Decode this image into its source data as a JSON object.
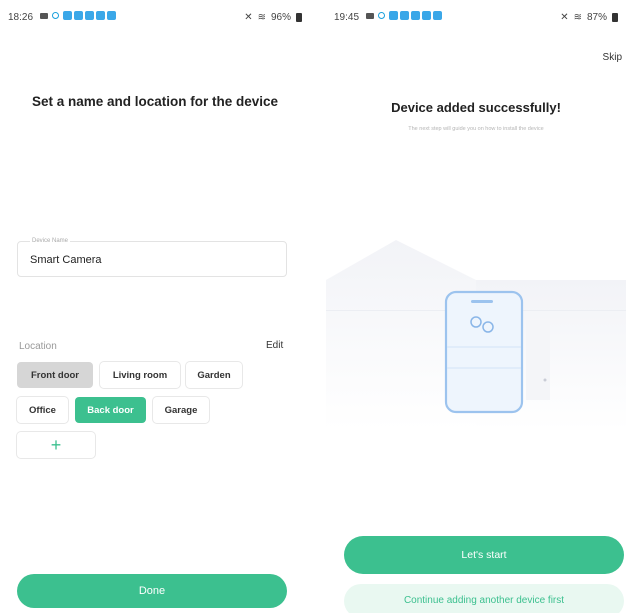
{
  "left_screen": {
    "status_bar": {
      "time": "18:26",
      "system": "96%"
    },
    "title": "Set a name and location for the device",
    "device_name": {
      "label": "Device Name",
      "value": "Smart Camera"
    },
    "location": {
      "label": "Location",
      "edit_label": "Edit",
      "rooms": [
        {
          "label": "Front door",
          "state": "highlighted"
        },
        {
          "label": "Living room",
          "state": "normal"
        },
        {
          "label": "Garden",
          "state": "normal"
        },
        {
          "label": "Office",
          "state": "normal"
        },
        {
          "label": "Back door",
          "state": "selected"
        },
        {
          "label": "Garage",
          "state": "normal"
        }
      ],
      "add_label": "+"
    },
    "done_label": "Done"
  },
  "right_screen": {
    "status_bar": {
      "time": "19:45",
      "system": "87%"
    },
    "skip_label": "Skip",
    "title": "Device added successfully!",
    "subtitle": "The next step will guide you on how to install the device",
    "start_label": "Let's start",
    "continue_label": "Continue adding another device first"
  },
  "colors": {
    "accent": "#3cc08f",
    "accent_light": "#e9f8f1",
    "chip_grey": "#d6d6d6"
  },
  "icons": [
    "message-icon",
    "sync-icon",
    "app-icon",
    "mute-icon",
    "wifi-icon",
    "battery-icon",
    "phone-illustration",
    "house-illustration"
  ]
}
